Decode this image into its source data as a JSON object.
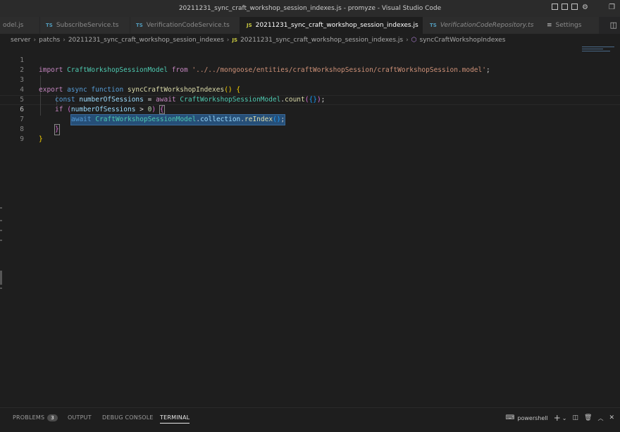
{
  "window": {
    "title": "20211231_sync_craft_workshop_session_indexes.js - promyze - Visual Studio Code"
  },
  "tabs": [
    {
      "label": "odel.js",
      "lang": ""
    },
    {
      "label": "SubscribeService.ts",
      "lang": "TS"
    },
    {
      "label": "VerificationCodeService.ts",
      "lang": "TS"
    },
    {
      "label": "20211231_sync_craft_workshop_session_indexes.js",
      "lang": "JS",
      "active": true
    },
    {
      "label": "VerificationCodeRepository.ts",
      "lang": "TS"
    },
    {
      "label": "Settings",
      "lang": ""
    }
  ],
  "breadcrumb": {
    "items": [
      "server",
      "patchs",
      "20211231_sync_craft_workshop_session_indexes",
      "20211231_sync_craft_workshop_session_indexes.js",
      "syncCraftWorkshopIndexes"
    ],
    "js_badge": "JS"
  },
  "code": {
    "line_numbers": [
      "1",
      "2",
      "3",
      "4",
      "5",
      "6",
      "7",
      "8",
      "9"
    ],
    "l1": {
      "kw_import": "import",
      "cls": "CraftWorkshopSessionModel",
      "kw_from": "from",
      "str": "'../../mongoose/entities/craftWorkshopSession/craftWorkshopSession.model'",
      "semi": ";"
    },
    "l3": {
      "kw_export": "export",
      "kw_async": "async",
      "kw_function": "function",
      "fn": "syncCraftWorkshopIndexes",
      "paren": "()",
      "brace": "{"
    },
    "l4": {
      "kw_const": "const",
      "var": "numberOfSessions",
      "eq": "=",
      "kw_await": "await",
      "cls": "CraftWorkshopSessionModel",
      "dot": ".",
      "fn": "count",
      "p_open": "(",
      "obj": "{}",
      "p_close": ")",
      "semi": ";"
    },
    "l5": {
      "kw_if": "if",
      "p_open": "(",
      "var": "numberOfSessions",
      "op": ">",
      "num": "0",
      "p_close": ")",
      "brace": "{"
    },
    "l6": {
      "kw_await": "await",
      "cls": "CraftWorkshopSessionModel",
      "dot1": ".",
      "prop": "collection",
      "dot2": ".",
      "fn": "reIndex",
      "parens": "()",
      "semi": ";"
    },
    "l7": {
      "brace": "}"
    },
    "l8": {
      "brace": "}"
    }
  },
  "panel": {
    "tabs": [
      "PROBLEMS",
      "OUTPUT",
      "DEBUG CONSOLE",
      "TERMINAL"
    ],
    "problems_count": "3",
    "terminal_shell": "powershell"
  }
}
